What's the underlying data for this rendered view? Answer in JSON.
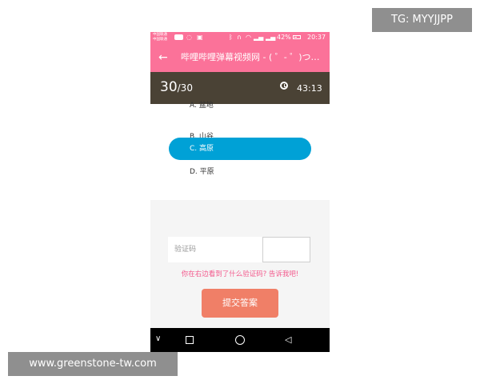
{
  "status_bar": {
    "carrier_line1": "中国联通",
    "carrier_line2": "中国联通",
    "battery_percent": "42%",
    "time": "20:37"
  },
  "app_bar": {
    "title": "哔哩哔哩弹幕视频网 - ( ゜- ゜)つロ 乾杯~"
  },
  "quiz": {
    "current": "30",
    "total": "/30",
    "timer": "43:13",
    "options": [
      {
        "label": "A. 盆地",
        "selected": false
      },
      {
        "label": "B. 山谷",
        "selected": false
      },
      {
        "label": "C. 高原",
        "selected": true
      },
      {
        "label": "D. 平原",
        "selected": false
      }
    ]
  },
  "captcha": {
    "placeholder": "验证码",
    "hint": "你在右边看到了什么验证码? 告诉我吧!"
  },
  "submit": {
    "label": "提交答案"
  },
  "watermarks": {
    "telegram": "TG: MYYJJPP",
    "site": "www.greenstone-tw.com"
  },
  "colors": {
    "brand_pink": "#fb7299",
    "quiz_bar": "#4a4235",
    "selected_option": "#00a1d6",
    "submit_button": "#f07f67",
    "hint_text": "#f45a8d"
  },
  "icons": [
    "back-arrow-icon",
    "alarm-clock-icon",
    "nav-back-icon",
    "nav-home-icon",
    "nav-recent-icon"
  ]
}
